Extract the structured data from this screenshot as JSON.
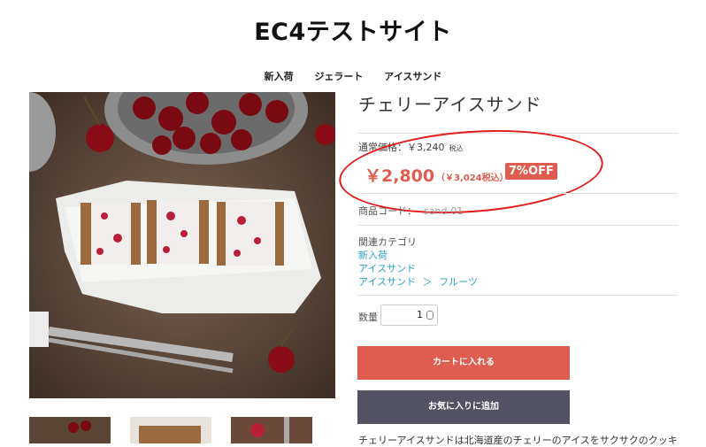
{
  "site": {
    "title": "EC4テストサイト"
  },
  "nav": {
    "items": [
      {
        "label": "新入荷"
      },
      {
        "label": "ジェラート"
      },
      {
        "label": "アイスサンド"
      }
    ]
  },
  "product": {
    "name": "チェリーアイスサンド",
    "regular_price_label": "通常価格：￥3,240",
    "regular_price_tax": "税込",
    "price": "￥2,800",
    "price_incl_tax": "（￥3,024税込）",
    "discount_badge": "7%OFF",
    "code_label": "商品コード：",
    "code_value": "sand-01",
    "category_title": "関連カテゴリ",
    "categories": [
      "新入荷",
      "アイスサンド"
    ],
    "category_path": {
      "parent": "アイスサンド",
      "sep": "＞",
      "child": "フルーツ"
    },
    "quantity_label": "数量",
    "quantity_value": "1",
    "add_to_cart": "カートに入れる",
    "add_to_favorites": "お気に入りに追加",
    "description": "チェリーアイスサンドは北海道産のチェリーのアイスをサクサクのクッキ"
  },
  "colors": {
    "accent": "#de5d50",
    "link": "#2da0cb",
    "dark_button": "#525263",
    "annotation": "#e31b1b"
  },
  "icons": {
    "quantity_stepper": "updown-stepper-icon"
  }
}
